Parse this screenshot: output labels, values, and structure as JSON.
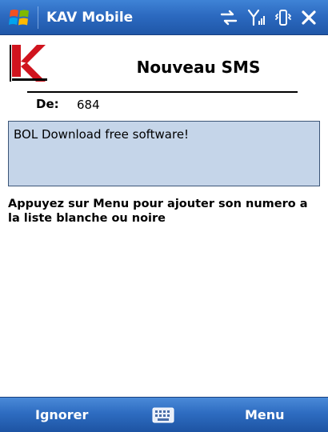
{
  "titlebar": {
    "app_title": "KAV Mobile",
    "icons": [
      "windows-start-icon",
      "sync-icon",
      "signal-icon",
      "vibrate-icon",
      "close-icon"
    ]
  },
  "header": {
    "title": "Nouveau SMS",
    "logo": "kaspersky-logo"
  },
  "sms": {
    "from_label": "De:",
    "from_value": "684",
    "body": "BOL Download free software!"
  },
  "instruction": "Appuyez sur Menu pour ajouter son numero a la liste blanche ou noire",
  "softkeys": {
    "left": "Ignorer",
    "right": "Menu",
    "center_icon": "keyboard-icon"
  },
  "colors": {
    "bar_blue": "#2c6ac0",
    "message_bg": "#c5d5e9",
    "logo_red": "#d0141e"
  }
}
